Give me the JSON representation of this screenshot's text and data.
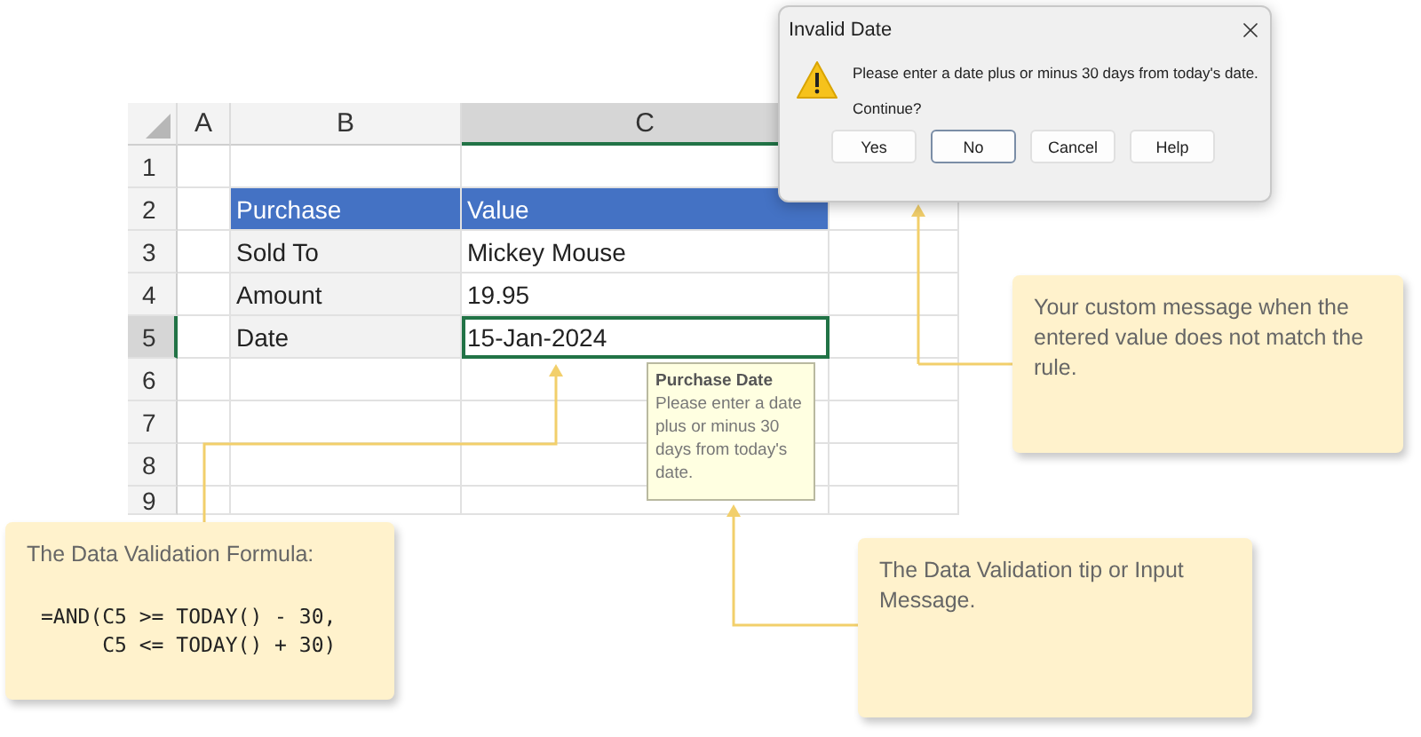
{
  "sheet": {
    "columns": [
      {
        "label": "A",
        "selected": false
      },
      {
        "label": "B",
        "selected": false
      },
      {
        "label": "C",
        "selected": true
      }
    ],
    "rows": [
      {
        "label": "1",
        "kind": "blank",
        "selected": false
      },
      {
        "label": "2",
        "kind": "heading",
        "selected": false,
        "b": "Purchase",
        "c": "Value"
      },
      {
        "label": "3",
        "kind": "data",
        "selected": false,
        "b": "Sold To",
        "c": "Mickey Mouse"
      },
      {
        "label": "4",
        "kind": "data",
        "selected": false,
        "b": "Amount",
        "c": "19.95"
      },
      {
        "label": "5",
        "kind": "data",
        "selected": true,
        "b": "Date",
        "c": "15-Jan-2024"
      },
      {
        "label": "6",
        "kind": "blank",
        "selected": false
      },
      {
        "label": "7",
        "kind": "blank",
        "selected": false
      },
      {
        "label": "8",
        "kind": "blank",
        "selected": false
      },
      {
        "label": "9",
        "kind": "blank",
        "selected": false
      }
    ]
  },
  "input_tip": {
    "title": "Purchase Date",
    "text": "Please enter a date plus or minus 30 days from today's date."
  },
  "dialog": {
    "title": "Invalid Date",
    "message": "Please enter a date plus or minus 30 days from today's date.",
    "question": "Continue?",
    "buttons": [
      {
        "label": "Yes",
        "selected": false
      },
      {
        "label": "No",
        "selected": true
      },
      {
        "label": "Cancel",
        "selected": false
      },
      {
        "label": "Help",
        "selected": false
      }
    ]
  },
  "callouts": [
    {
      "kind": "error",
      "text": "Your custom message when the entered value does not match the rule."
    },
    {
      "kind": "formula",
      "text": "The Data Validation Formula:",
      "formula": [
        "=AND(C5 >= TODAY() - 30,",
        "     C5 <= TODAY() + 30)"
      ]
    },
    {
      "kind": "tip",
      "text": "The Data Validation tip or Input Message."
    }
  ]
}
